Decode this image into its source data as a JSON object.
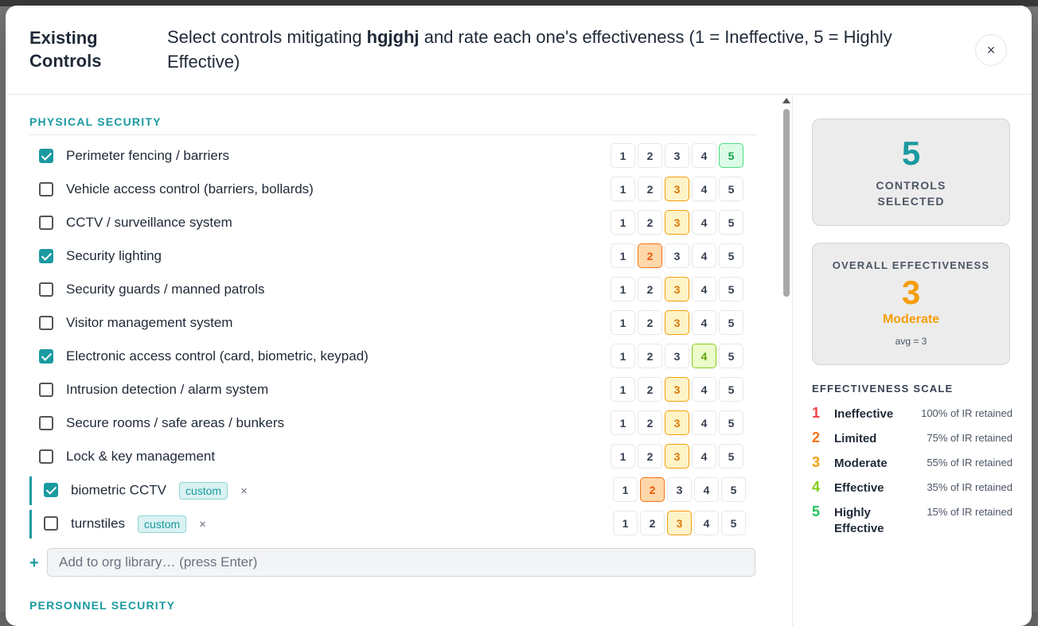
{
  "header": {
    "title": "Existing Controls",
    "subtitle_before": "Select controls mitigating ",
    "risk_name": "hgjghj",
    "subtitle_after": " and rate each one's effectiveness (1 = Ineffective, 5 = Highly Effective)",
    "close_label": "×"
  },
  "sections": [
    {
      "title": "PHYSICAL SECURITY"
    },
    {
      "title": "PERSONNEL SECURITY"
    }
  ],
  "rating_labels": [
    "1",
    "2",
    "3",
    "4",
    "5"
  ],
  "controls": [
    {
      "label": "Perimeter fencing / barriers",
      "checked": true,
      "rating": 5,
      "custom": false
    },
    {
      "label": "Vehicle access control (barriers, bollards)",
      "checked": false,
      "rating": 3,
      "custom": false
    },
    {
      "label": "CCTV / surveillance system",
      "checked": false,
      "rating": 3,
      "custom": false
    },
    {
      "label": "Security lighting",
      "checked": true,
      "rating": 2,
      "custom": false
    },
    {
      "label": "Security guards / manned patrols",
      "checked": false,
      "rating": 3,
      "custom": false
    },
    {
      "label": "Visitor management system",
      "checked": false,
      "rating": 3,
      "custom": false
    },
    {
      "label": "Electronic access control (card, biometric, keypad)",
      "checked": true,
      "rating": 4,
      "custom": false
    },
    {
      "label": "Intrusion detection / alarm system",
      "checked": false,
      "rating": 3,
      "custom": false
    },
    {
      "label": "Secure rooms / safe areas / bunkers",
      "checked": false,
      "rating": 3,
      "custom": false
    },
    {
      "label": "Lock & key management",
      "checked": false,
      "rating": 3,
      "custom": false
    },
    {
      "label": "biometric CCTV",
      "checked": true,
      "rating": 2,
      "custom": true
    },
    {
      "label": "turnstiles",
      "checked": false,
      "rating": 3,
      "custom": true
    }
  ],
  "custom_tag": "custom",
  "remove_label": "×",
  "add": {
    "plus": "+",
    "placeholder": "Add to org library… (press Enter)"
  },
  "summary": {
    "controls_selected": "5",
    "controls_selected_label": "CONTROLS SELECTED",
    "overall_label": "OVERALL EFFECTIVENESS",
    "overall_value": "3",
    "overall_text": "Moderate",
    "avg_text": "avg = 3"
  },
  "scale": {
    "title": "EFFECTIVENESS SCALE",
    "items": [
      {
        "num": "1",
        "name": "Ineffective",
        "pct": "100% of IR retained",
        "color": "#ef4444"
      },
      {
        "num": "2",
        "name": "Limited",
        "pct": "75% of IR retained",
        "color": "#f97316"
      },
      {
        "num": "3",
        "name": "Moderate",
        "pct": "55% of IR retained",
        "color": "#f59e0b"
      },
      {
        "num": "4",
        "name": "Effective",
        "pct": "35% of IR retained",
        "color": "#84cc16"
      },
      {
        "num": "5",
        "name": "Highly Effective",
        "pct": "15% of IR retained",
        "color": "#22c55e"
      }
    ]
  },
  "colors": {
    "accent": "#1a9aa0",
    "big_num": "#1a9aa0",
    "moderate": "#f59e0b"
  }
}
